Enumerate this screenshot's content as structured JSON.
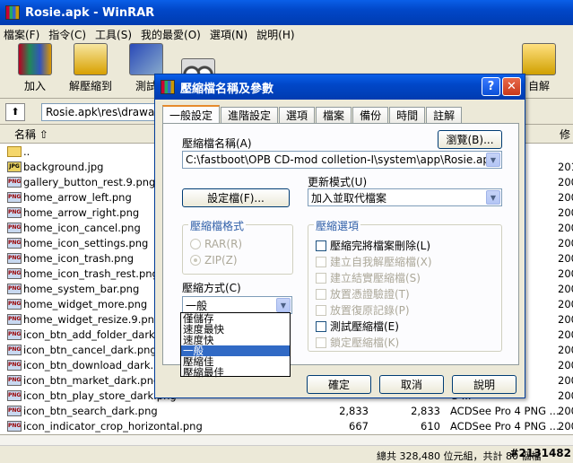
{
  "main_window": {
    "title": "Rosie.apk - WinRAR"
  },
  "menu": [
    "檔案(F)",
    "指令(C)",
    "工具(S)",
    "我的最愛(O)",
    "選項(N)",
    "說明(H)"
  ],
  "toolbar": {
    "add_label": "加入",
    "extract_label": "解壓縮到",
    "test_label": "測試",
    "sfx_label": "自解"
  },
  "path_bar": {
    "path": "Rosie.apk\\res\\drawab"
  },
  "file_list": {
    "col_name": "名稱",
    "col_modified": "修",
    "rows": [
      {
        "name": "..",
        "kind": "folder",
        "size": "",
        "packed": "",
        "type": "",
        "mod": ""
      },
      {
        "name": "background.jpg",
        "kind": "jpg",
        "size": "",
        "packed": "",
        "type": "EG ...",
        "mod": "201"
      },
      {
        "name": "gallery_button_rest.9.png",
        "kind": "png",
        "size": "",
        "packed": "",
        "type": "G ...",
        "mod": "200"
      },
      {
        "name": "home_arrow_left.png",
        "kind": "png",
        "size": "",
        "packed": "",
        "type": "G ...",
        "mod": "200"
      },
      {
        "name": "home_arrow_right.png",
        "kind": "png",
        "size": "",
        "packed": "",
        "type": "G ...",
        "mod": "200"
      },
      {
        "name": "home_icon_cancel.png",
        "kind": "png",
        "size": "",
        "packed": "",
        "type": "G ...",
        "mod": "200"
      },
      {
        "name": "home_icon_settings.png",
        "kind": "png",
        "size": "",
        "packed": "",
        "type": "G ...",
        "mod": "200"
      },
      {
        "name": "home_icon_trash.png",
        "kind": "png",
        "size": "",
        "packed": "",
        "type": "G ...",
        "mod": "200"
      },
      {
        "name": "home_icon_trash_rest.png",
        "kind": "png",
        "size": "",
        "packed": "",
        "type": "G ...",
        "mod": "200"
      },
      {
        "name": "home_system_bar.png",
        "kind": "png",
        "size": "",
        "packed": "",
        "type": "G ...",
        "mod": "200"
      },
      {
        "name": "home_widget_more.png",
        "kind": "png",
        "size": "",
        "packed": "",
        "type": "G ...",
        "mod": "200"
      },
      {
        "name": "home_widget_resize.9.png",
        "kind": "png",
        "size": "",
        "packed": "",
        "type": "G ...",
        "mod": "200"
      },
      {
        "name": "icon_btn_add_folder_dark.png",
        "kind": "png",
        "size": "",
        "packed": "",
        "type": "G ...",
        "mod": "200"
      },
      {
        "name": "icon_btn_cancel_dark.png",
        "kind": "png",
        "size": "",
        "packed": "",
        "type": "G ...",
        "mod": "200"
      },
      {
        "name": "icon_btn_download_dark.png",
        "kind": "png",
        "size": "",
        "packed": "",
        "type": "G ...",
        "mod": "200"
      },
      {
        "name": "icon_btn_market_dark.png",
        "kind": "png",
        "size": "",
        "packed": "",
        "type": "G ...",
        "mod": "200"
      },
      {
        "name": "icon_btn_play_store_dark.png",
        "kind": "png",
        "size": "",
        "packed": "",
        "type": "G ...",
        "mod": "200"
      },
      {
        "name": "icon_btn_search_dark.png",
        "kind": "png",
        "size": "2,833",
        "packed": "2,833",
        "type": "ACDSee Pro 4 PNG ...",
        "mod": "200"
      },
      {
        "name": "icon_indicator_crop_horizontal.png",
        "kind": "png",
        "size": "667",
        "packed": "610",
        "type": "ACDSee Pro 4 PNG ...",
        "mod": "200"
      }
    ]
  },
  "status": {
    "text": "總共 328,480 位元組，共計 80 個檔",
    "watermark": "#2131482"
  },
  "dialog": {
    "title": "壓縮檔名稱及參數",
    "tabs": [
      "一般設定",
      "進階設定",
      "選項",
      "檔案",
      "備份",
      "時間",
      "註解"
    ],
    "archive_name_label": "壓縮檔名稱(A)",
    "browse_label": "瀏覽(B)...",
    "archive_name_value": "C:\\fastboot\\OPB CD-mod colletion-I\\system\\app\\Rosie.apk",
    "update_mode_label": "更新模式(U)",
    "update_mode_value": "加入並取代檔案",
    "profiles_label": "設定檔(F)...",
    "format_group": "壓縮檔格式",
    "format_rar": "RAR(R)",
    "format_zip": "ZIP(Z)",
    "options_group": "壓縮選項",
    "options": [
      {
        "label": "壓縮完將檔案刪除(L)",
        "enabled": true
      },
      {
        "label": "建立自我解壓縮檔(X)",
        "enabled": false
      },
      {
        "label": "建立結實壓縮檔(S)",
        "enabled": false
      },
      {
        "label": "放置憑證驗證(T)",
        "enabled": false
      },
      {
        "label": "放置復原記錄(P)",
        "enabled": false
      },
      {
        "label": "測試壓縮檔(E)",
        "enabled": true
      },
      {
        "label": "鎖定壓縮檔(K)",
        "enabled": false
      }
    ],
    "method_label": "壓縮方式(C)",
    "method_value": "一般",
    "method_options": [
      "僅儲存",
      "速度最快",
      "速度快",
      "一般",
      "壓縮佳",
      "壓縮最佳"
    ],
    "ok_label": "確定",
    "cancel_label": "取消",
    "help_label": "說明"
  }
}
